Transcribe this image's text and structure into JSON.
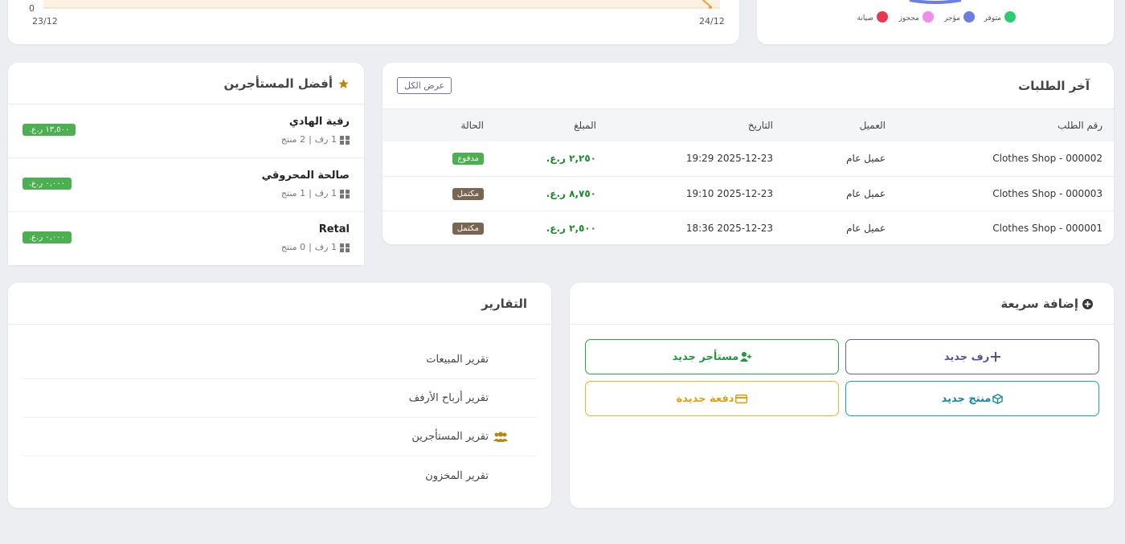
{
  "line_chart": {
    "y_tick": "0",
    "x_ticks": [
      "23/12",
      "24/12"
    ]
  },
  "status_legend": [
    {
      "label": "متوفر",
      "color": "#2ecc71"
    },
    {
      "label": "مؤجر",
      "color": "#6b7fe3"
    },
    {
      "label": "محجوز",
      "color": "#ee8ee8"
    },
    {
      "label": "صيانة",
      "color": "#e8384f"
    }
  ],
  "top_renters": {
    "title": "أفضل المستأجرين",
    "items": [
      {
        "name": "رقية الهادي",
        "shelves": "1 رف",
        "products": "2 منتج",
        "amount": "١٣,٥٠٠ ر.ع."
      },
      {
        "name": "صالحة المحروقي",
        "shelves": "1 رف",
        "products": "1 منتج",
        "amount": "٠,٠٠٠ ر.ع."
      },
      {
        "name": "Retal",
        "shelves": "1 رف",
        "products": "0 منتج",
        "amount": "٠,٠٠٠ ر.ع."
      }
    ]
  },
  "orders": {
    "title": "آخر الطلبات",
    "view_all": "عرض الكل",
    "headers": {
      "order_no": "رقم الطلب",
      "customer": "العميل",
      "date": "التاريخ",
      "amount": "المبلغ",
      "status": "الحالة"
    },
    "rows": [
      {
        "order_no": "Clothes Shop - 000002",
        "customer": "عميل عام",
        "date": "2025-12-23 19:29",
        "amount": "٢,٢٥٠ ر.ع.",
        "status": "مدفوع",
        "status_color": "#4caf50"
      },
      {
        "order_no": "Clothes Shop - 000003",
        "customer": "عميل عام",
        "date": "2025-12-23 19:10",
        "amount": "٨,٧٥٠ ر.ع.",
        "status": "مكتمل",
        "status_color": "#7a6552"
      },
      {
        "order_no": "Clothes Shop - 000001",
        "customer": "عميل عام",
        "date": "2025-12-23 18:36",
        "amount": "٢,٥٠٠ ر.ع.",
        "status": "مكتمل",
        "status_color": "#7a6552"
      }
    ]
  },
  "reports": {
    "title": "التقارير",
    "items": [
      "تقرير المبيعات",
      "تقرير أرباح الأرفف",
      "تقرير المستأجرين",
      "تقرير المخزون"
    ]
  },
  "quick_add": {
    "title": "إضافة سريعة",
    "new_shelf": "رف جديد",
    "new_renter": "مستأجر جديد",
    "new_product": "منتج جديد",
    "new_payment": "دفعة جديدة"
  },
  "colors": {
    "accent_purple": "#6a5fa8",
    "green": "#28a745",
    "teal": "#17a2b8",
    "yellow": "#f0b429",
    "star": "#b8860b"
  }
}
